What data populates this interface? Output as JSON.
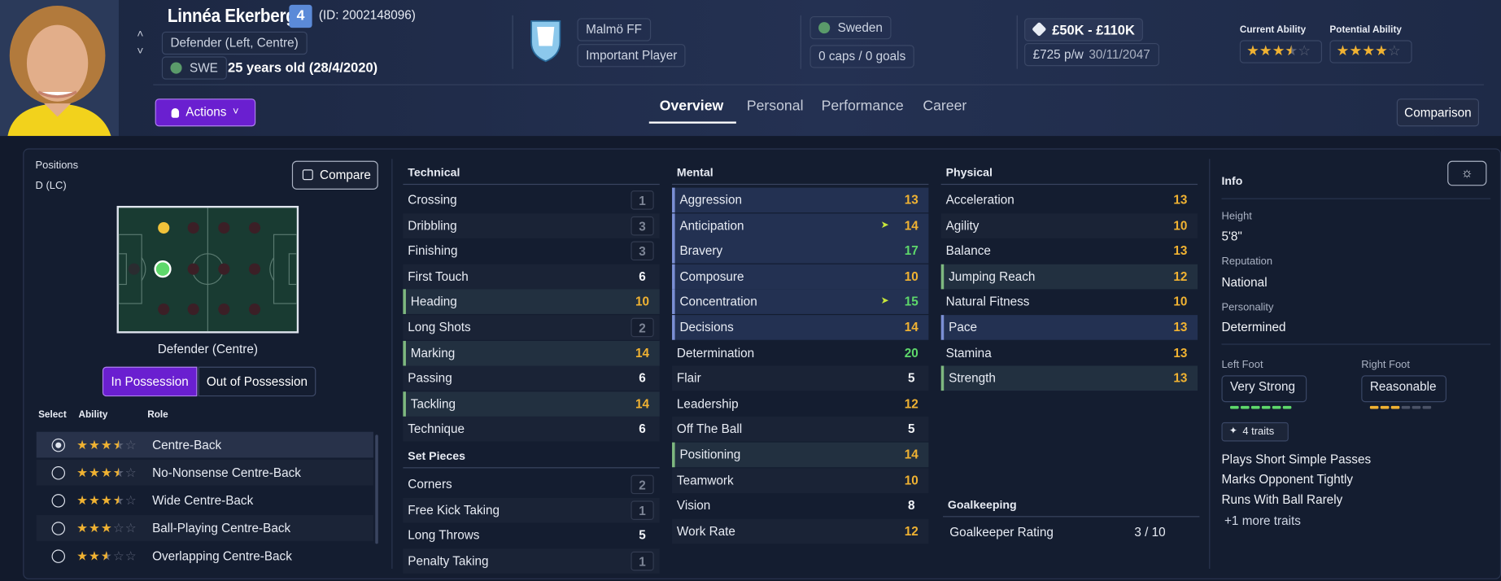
{
  "player": {
    "name": "Linnéa Ekerberg",
    "number": "4",
    "id": "(ID: 2002148096)",
    "position": "Defender (Left, Centre)",
    "nation_code": "SWE",
    "age": "25 years old (28/4/2020)"
  },
  "club": {
    "name": "Malmö FF",
    "status": "Important Player",
    "badge_text": "MALMÖ FF"
  },
  "nation": {
    "name": "Sweden",
    "caps": "0 caps / 0 goals"
  },
  "contract": {
    "value": "£50K - £110K",
    "wage": "£725 p/w",
    "expires": "30/11/2047"
  },
  "ability": {
    "current_label": "Current Ability",
    "potential_label": "Potential Ability",
    "current_stars": 3.5,
    "potential_stars": 4
  },
  "actions_label": "Actions",
  "comparison_label": "Comparison",
  "tabs": [
    {
      "label": "Overview",
      "active": true
    },
    {
      "label": "Personal",
      "active": false
    },
    {
      "label": "Performance",
      "active": false
    },
    {
      "label": "Career",
      "active": false
    }
  ],
  "positions": {
    "title": "Positions",
    "code": "D (LC)",
    "compare_label": "Compare",
    "pitch_caption": "Defender (Centre)",
    "toggle": [
      "In Possession",
      "Out of Possession"
    ]
  },
  "roles": {
    "headers": [
      "Select",
      "Ability",
      "Role"
    ],
    "items": [
      {
        "name": "Centre-Back",
        "stars": 3.5,
        "selected": true
      },
      {
        "name": "No-Nonsense Centre-Back",
        "stars": 3.5,
        "selected": false
      },
      {
        "name": "Wide Centre-Back",
        "stars": 3.5,
        "selected": false
      },
      {
        "name": "Ball-Playing Centre-Back",
        "stars": 3,
        "selected": false
      },
      {
        "name": "Overlapping Centre-Back",
        "stars": 2.5,
        "selected": false
      }
    ]
  },
  "technical": {
    "title": "Technical",
    "items": [
      {
        "name": "Crossing",
        "value": "1"
      },
      {
        "name": "Dribbling",
        "value": "3"
      },
      {
        "name": "Finishing",
        "value": "3"
      },
      {
        "name": "First Touch",
        "value": "6"
      },
      {
        "name": "Heading",
        "value": "10"
      },
      {
        "name": "Long Shots",
        "value": "2"
      },
      {
        "name": "Marking",
        "value": "14"
      },
      {
        "name": "Passing",
        "value": "6"
      },
      {
        "name": "Tackling",
        "value": "14"
      },
      {
        "name": "Technique",
        "value": "6"
      }
    ]
  },
  "set_pieces": {
    "title": "Set Pieces",
    "items": [
      {
        "name": "Corners",
        "value": "2"
      },
      {
        "name": "Free Kick Taking",
        "value": "1"
      },
      {
        "name": "Long Throws",
        "value": "5"
      },
      {
        "name": "Penalty Taking",
        "value": "1"
      }
    ]
  },
  "mental": {
    "title": "Mental",
    "items": [
      {
        "name": "Aggression",
        "value": "13"
      },
      {
        "name": "Anticipation",
        "value": "14"
      },
      {
        "name": "Bravery",
        "value": "17"
      },
      {
        "name": "Composure",
        "value": "10"
      },
      {
        "name": "Concentration",
        "value": "15"
      },
      {
        "name": "Decisions",
        "value": "14"
      },
      {
        "name": "Determination",
        "value": "20"
      },
      {
        "name": "Flair",
        "value": "5"
      },
      {
        "name": "Leadership",
        "value": "12"
      },
      {
        "name": "Off The Ball",
        "value": "5"
      },
      {
        "name": "Positioning",
        "value": "14"
      },
      {
        "name": "Teamwork",
        "value": "10"
      },
      {
        "name": "Vision",
        "value": "8"
      },
      {
        "name": "Work Rate",
        "value": "12"
      }
    ]
  },
  "physical": {
    "title": "Physical",
    "items": [
      {
        "name": "Acceleration",
        "value": "13"
      },
      {
        "name": "Agility",
        "value": "10"
      },
      {
        "name": "Balance",
        "value": "13"
      },
      {
        "name": "Jumping Reach",
        "value": "12"
      },
      {
        "name": "Natural Fitness",
        "value": "10"
      },
      {
        "name": "Pace",
        "value": "13"
      },
      {
        "name": "Stamina",
        "value": "13"
      },
      {
        "name": "Strength",
        "value": "13"
      }
    ]
  },
  "goalkeeping": {
    "title": "Goalkeeping",
    "label": "Goalkeeper Rating",
    "value": "3 / 10"
  },
  "info": {
    "title": "Info",
    "height_label": "Height",
    "height": "5'8\"",
    "reputation_label": "Reputation",
    "reputation": "National",
    "personality_label": "Personality",
    "personality": "Determined",
    "left_foot_label": "Left Foot",
    "left_foot": "Very Strong",
    "left_foot_level": 5,
    "right_foot_label": "Right Foot",
    "right_foot": "Reasonable",
    "right_foot_level": 3,
    "traits_badge": "4 traits",
    "traits": [
      "Plays Short Simple Passes",
      "Marks Opponent Tightly",
      "Runs With Ball Rarely"
    ],
    "more_traits": "+1 more traits"
  },
  "colors": {
    "accent": "#6a1fd0",
    "yellow": "#f0b232",
    "green": "#5ed86b"
  },
  "icons": [
    "chevron-up-icon",
    "chevron-down-icon",
    "person-icon",
    "tag-icon",
    "compare-icon",
    "sparkle-icon",
    "settings-icon",
    "flag-icon"
  ]
}
